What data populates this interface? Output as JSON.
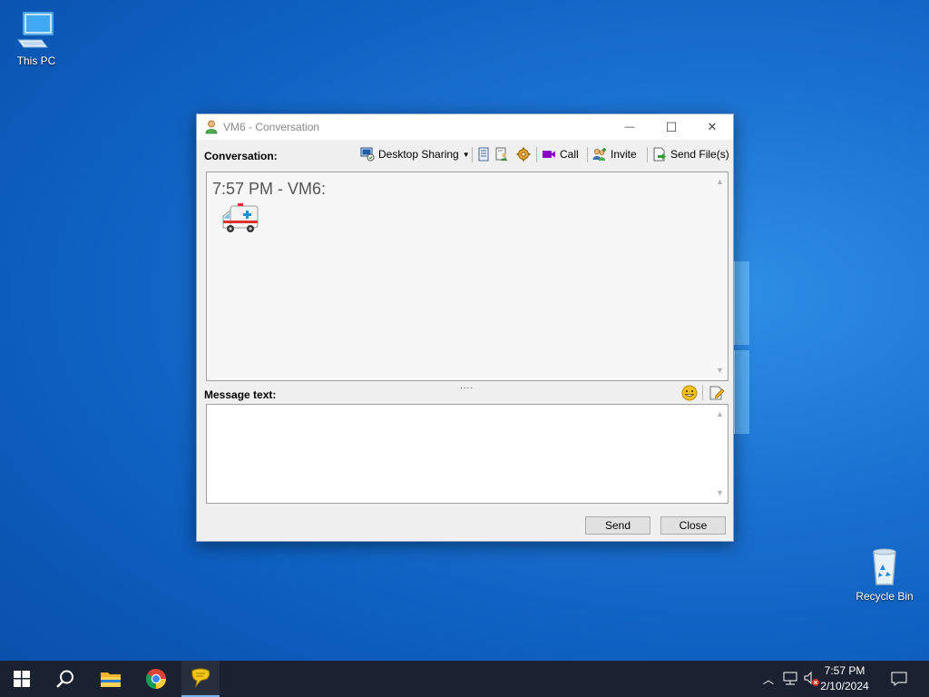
{
  "desktop": {
    "icons": [
      {
        "label": "This PC"
      },
      {
        "label": "Recycle Bin"
      }
    ]
  },
  "window": {
    "title": "VM6 - Conversation",
    "controls": {
      "minimize": "—",
      "maximize": "☐",
      "close": "✕"
    },
    "conversation_label": "Conversation:",
    "toolbar": {
      "desktop_sharing": "Desktop Sharing",
      "call": "Call",
      "invite": "Invite",
      "send_files": "Send File(s)"
    },
    "messages": [
      {
        "time_sender": "7:57 PM - VM6:",
        "content": "ambulance-emoji"
      }
    ],
    "message_text_label": "Message text:",
    "message_value": "",
    "grip": "....",
    "send_label": "Send",
    "close_label": "Close"
  },
  "taskbar": {
    "time": "7:57 PM",
    "date": "2/10/2024",
    "apps": [
      "start-icon",
      "search-icon",
      "file-explorer-icon",
      "chrome-icon",
      "messenger-icon"
    ]
  },
  "colors": {
    "desktop": "#1b72d2",
    "taskbar": "#1a2232",
    "call_icon": "#8a00c8"
  }
}
